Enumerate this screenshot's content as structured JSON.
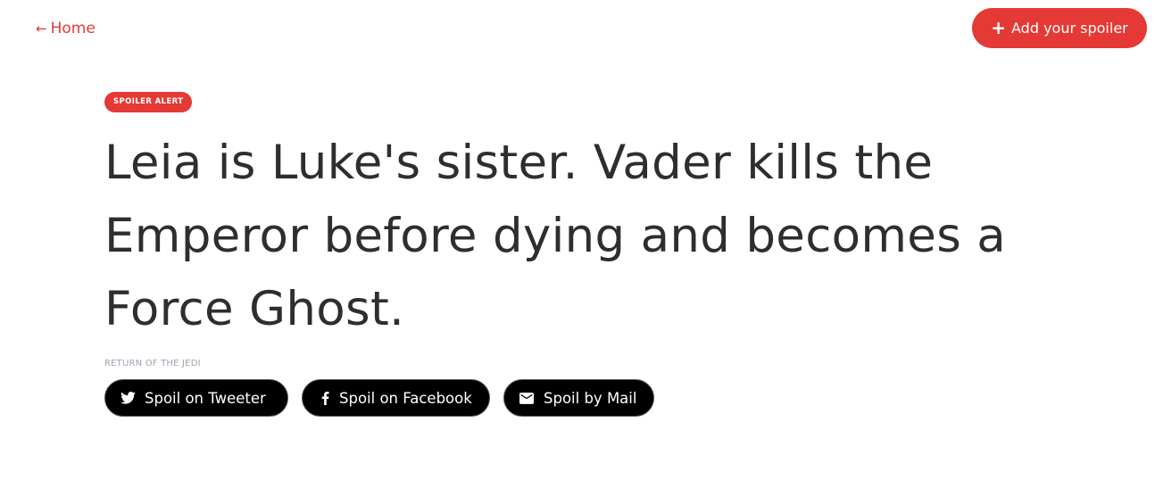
{
  "header": {
    "home_label": "Home",
    "add_label": "Add your spoiler"
  },
  "spoiler": {
    "badge": "SPOILER ALERT",
    "text": "Leia is Luke's sister. Vader kills the Emperor before dying and becomes a Force Ghost.",
    "movie": "RETURN OF THE JEDI"
  },
  "share": {
    "twitter_label": "Spoil on Tweeter",
    "facebook_label": "Spoil on Facebook",
    "mail_label": "Spoil by Mail"
  },
  "colors": {
    "accent": "#e53935",
    "share_bg": "#000000",
    "muted": "#9aa4b0"
  },
  "icons": [
    "arrow-left-icon",
    "plus-icon",
    "twitter-icon",
    "facebook-icon",
    "mail-icon"
  ]
}
